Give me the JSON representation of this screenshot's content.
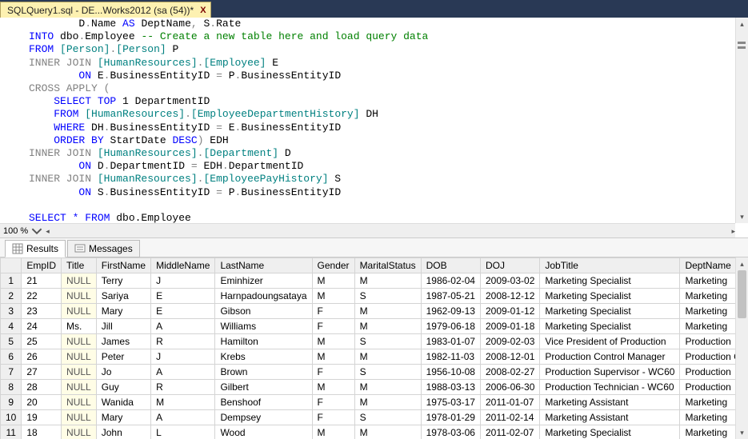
{
  "tab": {
    "title": "SQLQuery1.sql - DE...Works2012 (sa (54))*",
    "close": "X"
  },
  "editor": {
    "lines": [
      [
        {
          "t": "        D",
          "c": ""
        },
        {
          "t": ".",
          "c": "op"
        },
        {
          "t": "Name ",
          "c": ""
        },
        {
          "t": "AS",
          "c": "kw"
        },
        {
          "t": " DeptName",
          "c": ""
        },
        {
          "t": ",",
          "c": "op"
        },
        {
          "t": " S",
          "c": ""
        },
        {
          "t": ".",
          "c": "op"
        },
        {
          "t": "Rate",
          "c": ""
        }
      ],
      [
        {
          "t": "INTO",
          "c": "kw"
        },
        {
          "t": " dbo",
          "c": ""
        },
        {
          "t": ".",
          "c": "op"
        },
        {
          "t": "Employee ",
          "c": ""
        },
        {
          "t": "-- Create a new table here and load query data",
          "c": "cmt"
        }
      ],
      [
        {
          "t": "FROM",
          "c": "kw"
        },
        {
          "t": " ",
          "c": ""
        },
        {
          "t": "[Person]",
          "c": "sys"
        },
        {
          "t": ".",
          "c": "op"
        },
        {
          "t": "[Person]",
          "c": "sys"
        },
        {
          "t": " P",
          "c": ""
        }
      ],
      [
        {
          "t": "INNER JOIN",
          "c": "op"
        },
        {
          "t": " ",
          "c": ""
        },
        {
          "t": "[HumanResources]",
          "c": "sys"
        },
        {
          "t": ".",
          "c": "op"
        },
        {
          "t": "[Employee]",
          "c": "sys"
        },
        {
          "t": " E",
          "c": ""
        }
      ],
      [
        {
          "t": "        ",
          "c": ""
        },
        {
          "t": "ON",
          "c": "kw"
        },
        {
          "t": " E",
          "c": ""
        },
        {
          "t": ".",
          "c": "op"
        },
        {
          "t": "BusinessEntityID ",
          "c": ""
        },
        {
          "t": "=",
          "c": "op"
        },
        {
          "t": " P",
          "c": ""
        },
        {
          "t": ".",
          "c": "op"
        },
        {
          "t": "BusinessEntityID",
          "c": ""
        }
      ],
      [
        {
          "t": "CROSS APPLY",
          "c": "op"
        },
        {
          "t": " ",
          "c": ""
        },
        {
          "t": "(",
          "c": "op"
        }
      ],
      [
        {
          "t": "    ",
          "c": ""
        },
        {
          "t": "SELECT TOP",
          "c": "kw"
        },
        {
          "t": " 1 DepartmentID",
          "c": ""
        }
      ],
      [
        {
          "t": "    ",
          "c": ""
        },
        {
          "t": "FROM",
          "c": "kw"
        },
        {
          "t": " ",
          "c": ""
        },
        {
          "t": "[HumanResources]",
          "c": "sys"
        },
        {
          "t": ".",
          "c": "op"
        },
        {
          "t": "[EmployeeDepartmentHistory]",
          "c": "sys"
        },
        {
          "t": " DH",
          "c": ""
        }
      ],
      [
        {
          "t": "    ",
          "c": ""
        },
        {
          "t": "WHERE",
          "c": "kw"
        },
        {
          "t": " DH",
          "c": ""
        },
        {
          "t": ".",
          "c": "op"
        },
        {
          "t": "BusinessEntityID ",
          "c": ""
        },
        {
          "t": "=",
          "c": "op"
        },
        {
          "t": " E",
          "c": ""
        },
        {
          "t": ".",
          "c": "op"
        },
        {
          "t": "BusinessEntityID",
          "c": ""
        }
      ],
      [
        {
          "t": "    ",
          "c": ""
        },
        {
          "t": "ORDER BY",
          "c": "kw"
        },
        {
          "t": " StartDate ",
          "c": ""
        },
        {
          "t": "DESC",
          "c": "kw"
        },
        {
          "t": ")",
          "c": "op"
        },
        {
          "t": " EDH",
          "c": ""
        }
      ],
      [
        {
          "t": "INNER JOIN",
          "c": "op"
        },
        {
          "t": " ",
          "c": ""
        },
        {
          "t": "[HumanResources]",
          "c": "sys"
        },
        {
          "t": ".",
          "c": "op"
        },
        {
          "t": "[Department]",
          "c": "sys"
        },
        {
          "t": " D",
          "c": ""
        }
      ],
      [
        {
          "t": "        ",
          "c": ""
        },
        {
          "t": "ON",
          "c": "kw"
        },
        {
          "t": " D",
          "c": ""
        },
        {
          "t": ".",
          "c": "op"
        },
        {
          "t": "DepartmentID ",
          "c": ""
        },
        {
          "t": "=",
          "c": "op"
        },
        {
          "t": " EDH",
          "c": ""
        },
        {
          "t": ".",
          "c": "op"
        },
        {
          "t": "DepartmentID",
          "c": ""
        }
      ],
      [
        {
          "t": "INNER JOIN",
          "c": "op"
        },
        {
          "t": " ",
          "c": ""
        },
        {
          "t": "[HumanResources]",
          "c": "sys"
        },
        {
          "t": ".",
          "c": "op"
        },
        {
          "t": "[EmployeePayHistory]",
          "c": "sys"
        },
        {
          "t": " S",
          "c": ""
        }
      ],
      [
        {
          "t": "        ",
          "c": ""
        },
        {
          "t": "ON",
          "c": "kw"
        },
        {
          "t": " S",
          "c": ""
        },
        {
          "t": ".",
          "c": "op"
        },
        {
          "t": "BusinessEntityID ",
          "c": ""
        },
        {
          "t": "=",
          "c": "op"
        },
        {
          "t": " P",
          "c": ""
        },
        {
          "t": ".",
          "c": "op"
        },
        {
          "t": "BusinessEntityID",
          "c": ""
        }
      ],
      [
        {
          "t": " ",
          "c": ""
        }
      ],
      [
        {
          "t": "SELECT * FROM",
          "c": "kw"
        },
        {
          "t": " dbo.Employee",
          "c": ""
        }
      ]
    ]
  },
  "zoom": "100 %",
  "tabs2": {
    "results": "Results",
    "messages": "Messages"
  },
  "grid": {
    "columns": [
      "",
      "EmpID",
      "Title",
      "FirstName",
      "MiddleName",
      "LastName",
      "Gender",
      "MaritalStatus",
      "DOB",
      "DOJ",
      "JobTitle",
      "DeptName"
    ],
    "rows": [
      [
        "1",
        "21",
        "NULL",
        "Terry",
        "J",
        "Eminhizer",
        "M",
        "M",
        "1986-02-04",
        "2009-03-02",
        "Marketing Specialist",
        "Marketing"
      ],
      [
        "2",
        "22",
        "NULL",
        "Sariya",
        "E",
        "Harnpadoungsataya",
        "M",
        "S",
        "1987-05-21",
        "2008-12-12",
        "Marketing Specialist",
        "Marketing"
      ],
      [
        "3",
        "23",
        "NULL",
        "Mary",
        "E",
        "Gibson",
        "F",
        "M",
        "1962-09-13",
        "2009-01-12",
        "Marketing Specialist",
        "Marketing"
      ],
      [
        "4",
        "24",
        "Ms.",
        "Jill",
        "A",
        "Williams",
        "F",
        "M",
        "1979-06-18",
        "2009-01-18",
        "Marketing Specialist",
        "Marketing"
      ],
      [
        "5",
        "25",
        "NULL",
        "James",
        "R",
        "Hamilton",
        "M",
        "S",
        "1983-01-07",
        "2009-02-03",
        "Vice President of Production",
        "Production"
      ],
      [
        "6",
        "26",
        "NULL",
        "Peter",
        "J",
        "Krebs",
        "M",
        "M",
        "1982-11-03",
        "2008-12-01",
        "Production Control Manager",
        "Production Control"
      ],
      [
        "7",
        "27",
        "NULL",
        "Jo",
        "A",
        "Brown",
        "F",
        "S",
        "1956-10-08",
        "2008-02-27",
        "Production Supervisor - WC60",
        "Production"
      ],
      [
        "8",
        "28",
        "NULL",
        "Guy",
        "R",
        "Gilbert",
        "M",
        "M",
        "1988-03-13",
        "2006-06-30",
        "Production Technician - WC60",
        "Production"
      ],
      [
        "9",
        "20",
        "NULL",
        "Wanida",
        "M",
        "Benshoof",
        "F",
        "M",
        "1975-03-17",
        "2011-01-07",
        "Marketing Assistant",
        "Marketing"
      ],
      [
        "10",
        "19",
        "NULL",
        "Mary",
        "A",
        "Dempsey",
        "F",
        "S",
        "1978-01-29",
        "2011-02-14",
        "Marketing Assistant",
        "Marketing"
      ],
      [
        "11",
        "18",
        "NULL",
        "John",
        "L",
        "Wood",
        "M",
        "M",
        "1978-03-06",
        "2011-02-07",
        "Marketing Specialist",
        "Marketing"
      ]
    ]
  }
}
